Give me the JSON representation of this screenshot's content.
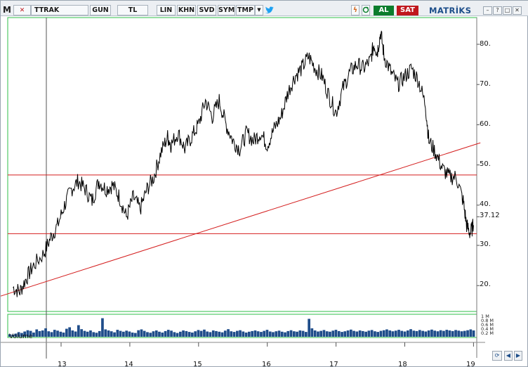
{
  "toolbar": {
    "logo": "M",
    "close_glyph": "✕",
    "symbol": "TTRAK",
    "period": "GUN",
    "currency": "TL",
    "buttons": [
      "LIN",
      "KHN",
      "SVD",
      "SYM",
      "TMP"
    ],
    "dropdown_glyph": "▼",
    "buy_label": "AL",
    "sell_label": "SAT",
    "brand": "MATRİKS",
    "colors": {
      "buy": "#0a7d2c",
      "sell": "#c0171d",
      "accent": "#1d4e8a",
      "twitter": "#1da1f2"
    }
  },
  "chart_data": {
    "type": "line",
    "current_value_label": "37.12",
    "y_ticks": [
      "80.",
      "70.",
      "60.",
      "50.",
      "40.",
      "30.",
      "20."
    ],
    "x_tick_labels": [
      "13",
      "14",
      "15",
      "16",
      "17",
      "18",
      "19"
    ],
    "ylim": [
      13.5,
      86
    ],
    "series": [
      {
        "points": [
          [
            12.3,
            19.5
          ],
          [
            12.4,
            18.5
          ],
          [
            12.5,
            22
          ],
          [
            12.6,
            25
          ],
          [
            12.75,
            28
          ],
          [
            12.85,
            32
          ],
          [
            12.95,
            35
          ],
          [
            13.05,
            40
          ],
          [
            13.15,
            44
          ],
          [
            13.25,
            46
          ],
          [
            13.35,
            44
          ],
          [
            13.45,
            41
          ],
          [
            13.55,
            46
          ],
          [
            13.65,
            44
          ],
          [
            13.75,
            45
          ],
          [
            13.85,
            42
          ],
          [
            13.95,
            37
          ],
          [
            14.05,
            42
          ],
          [
            14.15,
            39
          ],
          [
            14.25,
            44
          ],
          [
            14.35,
            47
          ],
          [
            14.45,
            53
          ],
          [
            14.55,
            57
          ],
          [
            14.6,
            55
          ],
          [
            14.7,
            58
          ],
          [
            14.8,
            54
          ],
          [
            14.9,
            57
          ],
          [
            15.0,
            60
          ],
          [
            15.1,
            66
          ],
          [
            15.2,
            62
          ],
          [
            15.3,
            66
          ],
          [
            15.4,
            60
          ],
          [
            15.5,
            56
          ],
          [
            15.6,
            54
          ],
          [
            15.7,
            58
          ],
          [
            15.8,
            56
          ],
          [
            15.9,
            58
          ],
          [
            16.0,
            55
          ],
          [
            16.1,
            59
          ],
          [
            16.2,
            62
          ],
          [
            16.3,
            68
          ],
          [
            16.4,
            72
          ],
          [
            16.5,
            74
          ],
          [
            16.6,
            77
          ],
          [
            16.7,
            74
          ],
          [
            16.8,
            72
          ],
          [
            16.9,
            67
          ],
          [
            17.0,
            63
          ],
          [
            17.1,
            69
          ],
          [
            17.2,
            73
          ],
          [
            17.3,
            75
          ],
          [
            17.4,
            74
          ],
          [
            17.5,
            76
          ],
          [
            17.55,
            80
          ],
          [
            17.6,
            78
          ],
          [
            17.65,
            83
          ],
          [
            17.7,
            77
          ],
          [
            17.8,
            73
          ],
          [
            17.9,
            70
          ],
          [
            18.0,
            72
          ],
          [
            18.1,
            74
          ],
          [
            18.2,
            71
          ],
          [
            18.3,
            65
          ],
          [
            18.35,
            56
          ],
          [
            18.45,
            53
          ],
          [
            18.55,
            49
          ],
          [
            18.65,
            47
          ],
          [
            18.75,
            47
          ],
          [
            18.85,
            41
          ],
          [
            18.9,
            35
          ],
          [
            18.95,
            33
          ],
          [
            19.0,
            35
          ]
        ]
      }
    ],
    "horizontal_lines": [
      47.5,
      32.9
    ],
    "trendline": [
      [
        12.05,
        17.0
      ],
      [
        19.1,
        55.5
      ]
    ],
    "volume_label": "Volume",
    "volume_ticks": [
      "1 M",
      "0.8 M",
      "0.6 M",
      "0.4 M",
      "0.2 M"
    ],
    "volume": [
      0.12,
      0.1,
      0.15,
      0.22,
      0.18,
      0.25,
      0.31,
      0.28,
      0.2,
      0.35,
      0.27,
      0.3,
      0.4,
      0.26,
      0.22,
      0.33,
      0.29,
      0.24,
      0.2,
      0.38,
      0.45,
      0.3,
      0.25,
      0.55,
      0.36,
      0.28,
      0.24,
      0.3,
      0.22,
      0.19,
      0.27,
      0.88,
      0.35,
      0.3,
      0.26,
      0.21,
      0.33,
      0.28,
      0.24,
      0.29,
      0.25,
      0.2,
      0.18,
      0.31,
      0.35,
      0.28,
      0.22,
      0.19,
      0.26,
      0.3,
      0.24,
      0.2,
      0.27,
      0.33,
      0.29,
      0.22,
      0.18,
      0.24,
      0.3,
      0.27,
      0.23,
      0.2,
      0.26,
      0.32,
      0.28,
      0.34,
      0.25,
      0.22,
      0.3,
      0.27,
      0.24,
      0.21,
      0.29,
      0.36,
      0.26,
      0.23,
      0.28,
      0.31,
      0.25,
      0.2,
      0.24,
      0.27,
      0.3,
      0.26,
      0.23,
      0.28,
      0.33,
      0.25,
      0.22,
      0.26,
      0.29,
      0.24,
      0.21,
      0.27,
      0.31,
      0.26,
      0.24,
      0.3,
      0.28,
      0.23,
      0.85,
      0.4,
      0.3,
      0.25,
      0.28,
      0.32,
      0.26,
      0.24,
      0.29,
      0.33,
      0.27,
      0.23,
      0.26,
      0.3,
      0.34,
      0.28,
      0.25,
      0.3,
      0.27,
      0.24,
      0.29,
      0.32,
      0.26,
      0.23,
      0.28,
      0.31,
      0.35,
      0.3,
      0.26,
      0.29,
      0.33,
      0.28,
      0.25,
      0.3,
      0.36,
      0.29,
      0.27,
      0.32,
      0.28,
      0.25,
      0.3,
      0.34,
      0.29,
      0.26,
      0.31,
      0.28,
      0.33,
      0.3,
      0.27,
      0.32,
      0.29,
      0.26,
      0.28,
      0.31,
      0.35,
      0.3
    ]
  }
}
